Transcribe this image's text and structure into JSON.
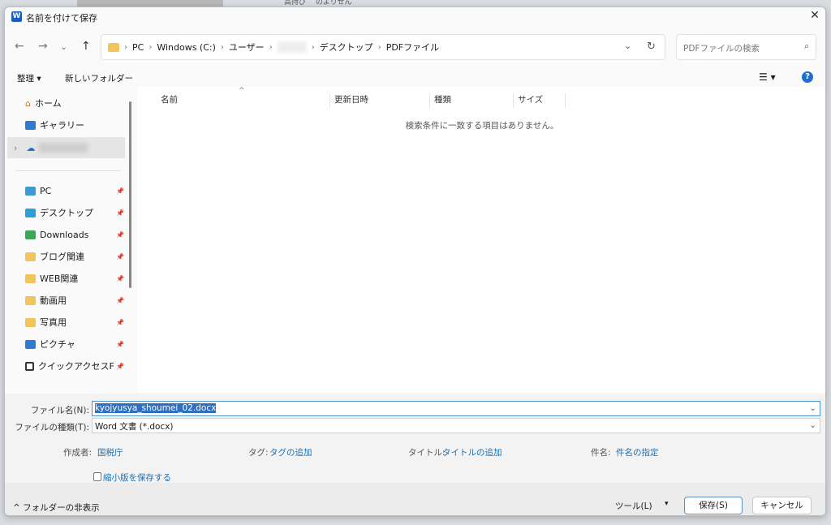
{
  "background": {
    "behind_text": "高持び゛ のよりせん"
  },
  "dialog": {
    "title": "名前を付けて保存",
    "app_icon": "W",
    "close": "✕"
  },
  "nav": {
    "back": "←",
    "forward": "→",
    "recent": "⌄",
    "up": "↑"
  },
  "address": {
    "segments": [
      "PC",
      "Windows (C:)",
      "ユーザー",
      "",
      "デスクトップ",
      "PDFファイル"
    ],
    "dropdown": "⌄",
    "refresh": "↻"
  },
  "search": {
    "placeholder": "PDFファイルの検索",
    "icon": "⌕"
  },
  "toolbar": {
    "organize": "整理 ▾",
    "new_folder": "新しいフォルダー",
    "view": "☰ ▾",
    "help": "?"
  },
  "sidebar": {
    "items": [
      {
        "label": "ホーム",
        "icon": "home-icon",
        "pinned": false
      },
      {
        "label": "ギャラリー",
        "icon": "gallery-icon",
        "pinned": false
      },
      {
        "label": "",
        "icon": "onedrive-icon",
        "pinned": false,
        "expander": "›"
      },
      {
        "label": "PC",
        "icon": "pc-icon",
        "pinned": true
      },
      {
        "label": "デスクトップ",
        "icon": "desktop-icon",
        "pinned": true
      },
      {
        "label": "Downloads",
        "icon": "downloads-icon",
        "pinned": true
      },
      {
        "label": "ブログ関連",
        "icon": "folder-icon",
        "pinned": true
      },
      {
        "label": "WEB関連",
        "icon": "folder-icon",
        "pinned": true
      },
      {
        "label": "動画用",
        "icon": "folder-icon",
        "pinned": true
      },
      {
        "label": "写真用",
        "icon": "folder-icon",
        "pinned": true
      },
      {
        "label": "ピクチャ",
        "icon": "pictures-icon",
        "pinned": true
      },
      {
        "label": "クイックアクセスF",
        "icon": "quickaccess-icon",
        "pinned": true
      }
    ],
    "pin": "📌"
  },
  "list": {
    "columns": [
      "名前",
      "更新日時",
      "種類",
      "サイズ"
    ],
    "sort_indicator": "^",
    "empty_message": "検索条件に一致する項目はありません。"
  },
  "form": {
    "filename_label": "ファイル名(N):",
    "filename_value": "kyojyusya_shoumei_02.docx",
    "filetype_label": "ファイルの種類(T):",
    "filetype_value": "Word 文書 (*.docx)",
    "author_label": "作成者:",
    "author_value": "国税庁",
    "tags_label": "タグ:",
    "tags_value": "タグの追加",
    "title_label": "タイトル:",
    "title_value": "タイトルの追加",
    "subject_label": "件名:",
    "subject_value": "件名の指定",
    "thumbnail_label": "縮小版を保存する",
    "thumbnail_checked": false
  },
  "footer": {
    "hide_folders": "^ フォルダーの非表示",
    "tools": "ツール(L)",
    "tools_arrow": "▾",
    "save": "保存(S)",
    "cancel": "キャンセル"
  }
}
